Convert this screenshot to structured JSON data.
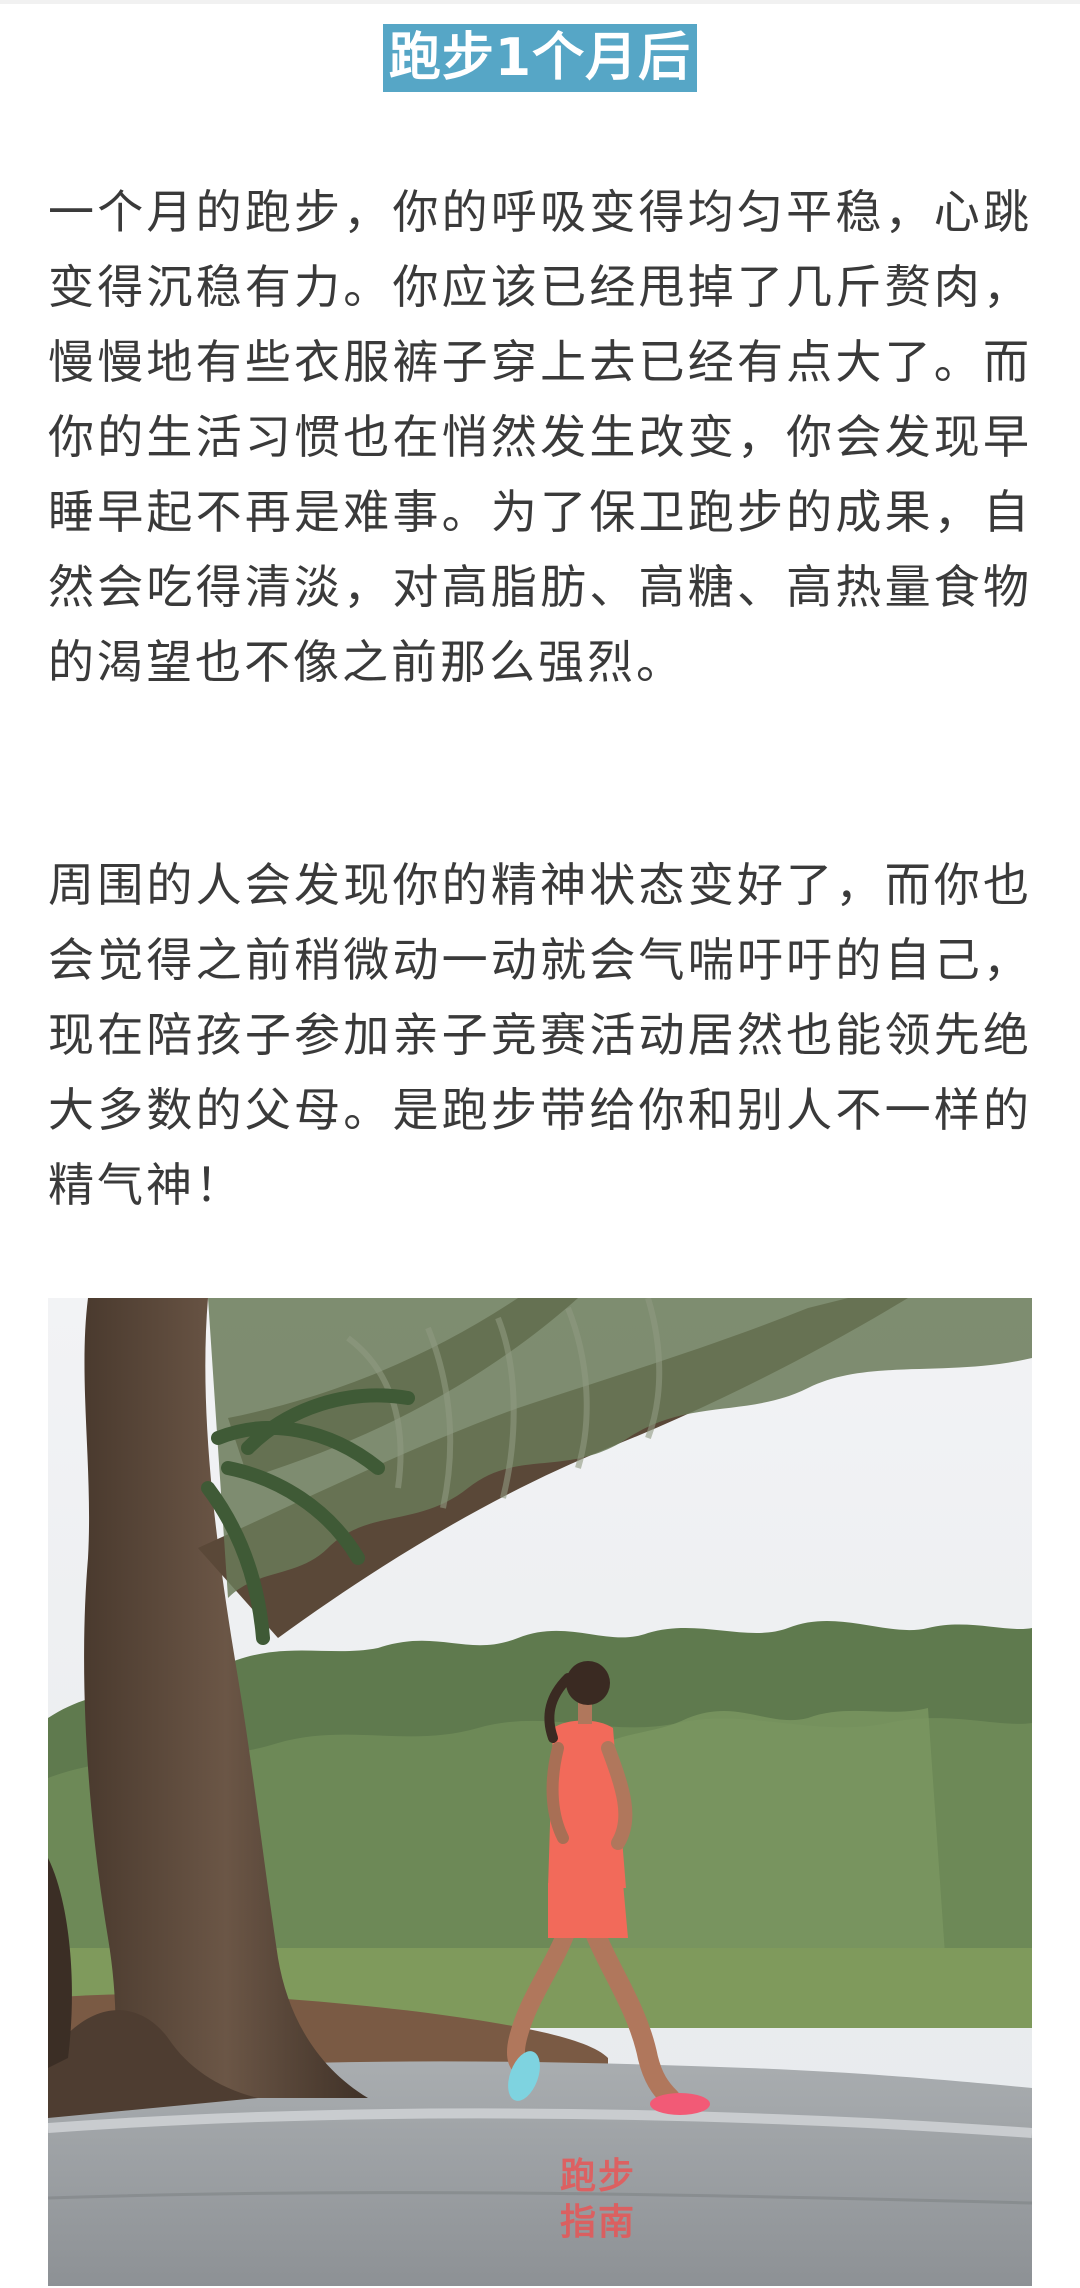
{
  "article": {
    "heading": "跑步1个月后",
    "paragraphs": [
      "一个月的跑步，你的呼吸变得均匀平稳，心跳变得沉稳有力。你应该已经甩掉了几斤赘肉，慢慢地有些衣服裤子穿上去已经有点大了。而你的生活习惯也在悄然发生改变，你会发现早睡早起不再是难事。为了保卫跑步的成果，自然会吃得清淡，对高脂肪、高糖、高热量食物的渴望也不像之前那么强烈。",
      "周围的人会发现你的精神状态变好了，而你也会觉得之前稍微动一动就会气喘吁吁的自己，现在陪孩子参加亲子竞赛活动居然也能领先绝大多数的父母。是跑步带给你和别人不一样的精气神！"
    ],
    "photo": {
      "watermark_line1": "跑步",
      "watermark_line2": "指南"
    }
  },
  "colors": {
    "heading_bg": "#56a6c6",
    "heading_text": "#ffffff",
    "body_text": "#3a3a3a",
    "watermark": "#ee5050",
    "runner_outfit": "#f26a5a"
  }
}
